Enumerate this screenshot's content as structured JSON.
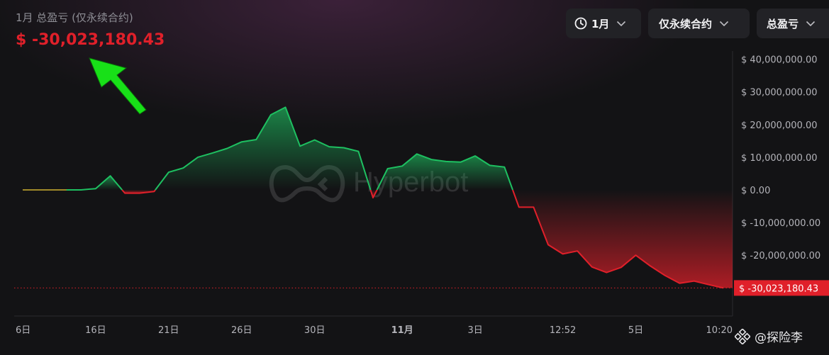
{
  "header": {
    "label": "1月 总盈亏 (仅永续合约)",
    "value": "$ -30,023,180.43"
  },
  "controls": {
    "period": "1月",
    "contract": "仅永续合约",
    "metric": "总盈亏"
  },
  "brand": {
    "name": "Hyperbot"
  },
  "watermark": {
    "text": "@探险李"
  },
  "colors": {
    "profit": "#1ec061",
    "loss": "#e0202a",
    "arrow": "#18e018",
    "background": "#131315"
  },
  "chart_data": {
    "type": "area",
    "y_ticks": [
      40000000,
      30000000,
      20000000,
      10000000,
      0,
      -10000000,
      -20000000
    ],
    "y_tick_labels": [
      "$ 40,000,000.00",
      "$ 30,000,000.00",
      "$ 20,000,000.00",
      "$ 10,000,000.00",
      "$ 0.00",
      "$ -10,000,000.00",
      "$ -20,000,000.00"
    ],
    "ylim": [
      -31500000,
      43000000
    ],
    "x_tick_labels": [
      "6日",
      "16日",
      "21日",
      "26日",
      "30日",
      "11月",
      "3日",
      "12:52",
      "5日",
      "10:20"
    ],
    "x_tick_index": [
      0,
      5,
      10,
      15,
      20,
      26,
      31,
      37,
      42,
      48
    ],
    "last_value": -30023180.43,
    "last_value_label": "$ -30,023,180.43",
    "series": [
      {
        "values": [
          0,
          0,
          0,
          0,
          0,
          400000,
          4300000,
          -1000000,
          -1000000,
          -500000,
          5400000,
          6700000,
          10000000,
          11300000,
          12700000,
          14700000,
          15400000,
          23000000,
          25300000,
          13400000,
          15300000,
          13200000,
          12900000,
          11800000,
          -2400000,
          6500000,
          7300000,
          11000000,
          9300000,
          8700000,
          8500000,
          10400000,
          7500000,
          7000000,
          -5300000,
          -5300000,
          -16800000,
          -19600000,
          -18700000,
          -23600000,
          -25300000,
          -23700000,
          -20000000,
          -23300000,
          -26200000,
          -28600000,
          -27900000,
          -29000000,
          -30023180.43
        ]
      }
    ]
  }
}
